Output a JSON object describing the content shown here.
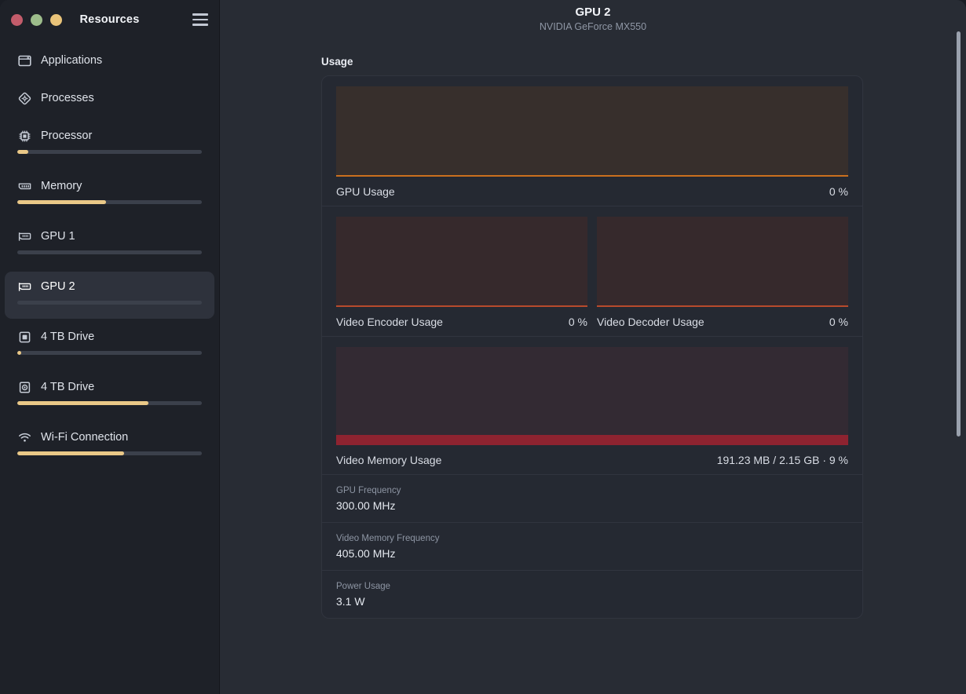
{
  "window": {
    "sidebar_title": "Resources",
    "traffic_lights": [
      {
        "name": "close",
        "color": "#c35c6b"
      },
      {
        "name": "minimize",
        "color": "#9dbd8b"
      },
      {
        "name": "maximize",
        "color": "#e9c379"
      }
    ],
    "menu_icon": "hamburger-icon"
  },
  "sidebar": {
    "items": [
      {
        "label": "Applications",
        "icon": "application-window-icon",
        "has_bar": false,
        "bar_percent": 0,
        "bar_style": "none",
        "selected": false
      },
      {
        "label": "Processes",
        "icon": "processes-icon",
        "has_bar": false,
        "bar_percent": 0,
        "bar_style": "none",
        "selected": false
      },
      {
        "label": "Processor",
        "icon": "cpu-chip-icon",
        "has_bar": true,
        "bar_percent": 6,
        "bar_style": "accent",
        "selected": false
      },
      {
        "label": "Memory",
        "icon": "memory-stick-icon",
        "has_bar": true,
        "bar_percent": 48,
        "bar_style": "accent",
        "selected": false
      },
      {
        "label": "GPU 1",
        "icon": "graphics-card-icon",
        "has_bar": true,
        "bar_percent": 0,
        "bar_style": "neutral",
        "selected": false
      },
      {
        "label": "GPU 2",
        "icon": "graphics-card-icon",
        "has_bar": true,
        "bar_percent": 0,
        "bar_style": "neutral",
        "selected": true
      },
      {
        "label": "4 TB Drive",
        "icon": "ssd-drive-icon",
        "has_bar": true,
        "bar_percent": 2,
        "bar_style": "accent",
        "selected": false
      },
      {
        "label": "4 TB Drive",
        "icon": "hard-drive-icon",
        "has_bar": true,
        "bar_percent": 71,
        "bar_style": "accent",
        "selected": false
      },
      {
        "label": "Wi-Fi Connection",
        "icon": "wifi-icon",
        "has_bar": true,
        "bar_percent": 58,
        "bar_style": "accent",
        "selected": false
      }
    ]
  },
  "main": {
    "title": "GPU 2",
    "subtitle": "NVIDIA GeForce MX550",
    "section_label": "Usage",
    "graphs": {
      "gpu_usage": {
        "name": "GPU Usage",
        "value": "0 %"
      },
      "video_encoder": {
        "name": "Video Encoder Usage",
        "value": "0 %"
      },
      "video_decoder": {
        "name": "Video Decoder Usage",
        "value": "0 %"
      },
      "video_memory": {
        "name": "Video Memory Usage",
        "value": "191.23 MB / 2.15 GB · 9 %"
      }
    },
    "info_rows": [
      {
        "key": "GPU Frequency",
        "value": "300.00 MHz"
      },
      {
        "key": "Video Memory Frequency",
        "value": "405.00 MHz"
      },
      {
        "key": "Power Usage",
        "value": "3.1 W"
      }
    ]
  },
  "colors": {
    "accent": "#eac887",
    "gpu_line": "#cb701e",
    "codec_line": "#b84a2c",
    "vram_line": "#8e2330",
    "sidebar_bg": "#1e2128",
    "main_bg": "#282c34",
    "card_bg": "#252932"
  }
}
